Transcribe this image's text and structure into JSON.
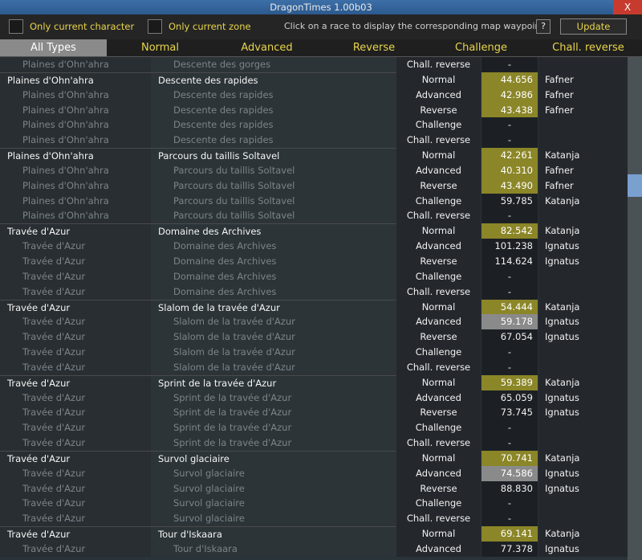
{
  "window": {
    "title": "DragonTimes 1.00b03",
    "close": "X"
  },
  "toolbar": {
    "only_character_label": "Only current character",
    "only_zone_label": "Only current zone",
    "hint": "Click on a race to display the corresponding map waypoint.",
    "help_label": "?",
    "update_label": "Update"
  },
  "tabs": [
    "All Types",
    "Normal",
    "Advanced",
    "Reverse",
    "Challenge",
    "Chall. reverse"
  ],
  "colors": {
    "gold_cell": "#8b8628",
    "gray_cell": "#8a8a8a",
    "accent_text": "#e8d44a"
  },
  "rows": [
    {
      "kind": "sub",
      "zone": "Plaines d'Ohn'ahra",
      "race": "Descente des gorges",
      "type": "Chall. reverse",
      "time": "-",
      "player": "",
      "hl": ""
    },
    {
      "kind": "main",
      "zone": "Plaines d'Ohn'ahra",
      "race": "Descente des rapides",
      "type": "Normal",
      "time": "44.656",
      "player": "Fafner",
      "hl": "gold"
    },
    {
      "kind": "sub",
      "zone": "Plaines d'Ohn'ahra",
      "race": "Descente des rapides",
      "type": "Advanced",
      "time": "42.986",
      "player": "Fafner",
      "hl": "gold"
    },
    {
      "kind": "sub",
      "zone": "Plaines d'Ohn'ahra",
      "race": "Descente des rapides",
      "type": "Reverse",
      "time": "43.438",
      "player": "Fafner",
      "hl": "gold"
    },
    {
      "kind": "sub",
      "zone": "Plaines d'Ohn'ahra",
      "race": "Descente des rapides",
      "type": "Challenge",
      "time": "-",
      "player": "",
      "hl": ""
    },
    {
      "kind": "sub",
      "zone": "Plaines d'Ohn'ahra",
      "race": "Descente des rapides",
      "type": "Chall. reverse",
      "time": "-",
      "player": "",
      "hl": ""
    },
    {
      "kind": "main",
      "zone": "Plaines d'Ohn'ahra",
      "race": "Parcours du taillis Soltavel",
      "type": "Normal",
      "time": "42.261",
      "player": "Katanja",
      "hl": "gold"
    },
    {
      "kind": "sub",
      "zone": "Plaines d'Ohn'ahra",
      "race": "Parcours du taillis Soltavel",
      "type": "Advanced",
      "time": "40.310",
      "player": "Fafner",
      "hl": "gold"
    },
    {
      "kind": "sub",
      "zone": "Plaines d'Ohn'ahra",
      "race": "Parcours du taillis Soltavel",
      "type": "Reverse",
      "time": "43.490",
      "player": "Fafner",
      "hl": "gold"
    },
    {
      "kind": "sub",
      "zone": "Plaines d'Ohn'ahra",
      "race": "Parcours du taillis Soltavel",
      "type": "Challenge",
      "time": "59.785",
      "player": "Katanja",
      "hl": ""
    },
    {
      "kind": "sub",
      "zone": "Plaines d'Ohn'ahra",
      "race": "Parcours du taillis Soltavel",
      "type": "Chall. reverse",
      "time": "-",
      "player": "",
      "hl": ""
    },
    {
      "kind": "main",
      "zone": "Travée d'Azur",
      "race": "Domaine des Archives",
      "type": "Normal",
      "time": "82.542",
      "player": "Katanja",
      "hl": "gold"
    },
    {
      "kind": "sub",
      "zone": "Travée d'Azur",
      "race": "Domaine des Archives",
      "type": "Advanced",
      "time": "101.238",
      "player": "Ignatus",
      "hl": ""
    },
    {
      "kind": "sub",
      "zone": "Travée d'Azur",
      "race": "Domaine des Archives",
      "type": "Reverse",
      "time": "114.624",
      "player": "Ignatus",
      "hl": ""
    },
    {
      "kind": "sub",
      "zone": "Travée d'Azur",
      "race": "Domaine des Archives",
      "type": "Challenge",
      "time": "-",
      "player": "",
      "hl": ""
    },
    {
      "kind": "sub",
      "zone": "Travée d'Azur",
      "race": "Domaine des Archives",
      "type": "Chall. reverse",
      "time": "-",
      "player": "",
      "hl": ""
    },
    {
      "kind": "main",
      "zone": "Travée d'Azur",
      "race": "Slalom de la travée d'Azur",
      "type": "Normal",
      "time": "54.444",
      "player": "Katanja",
      "hl": "gold"
    },
    {
      "kind": "sub",
      "zone": "Travée d'Azur",
      "race": "Slalom de la travée d'Azur",
      "type": "Advanced",
      "time": "59.178",
      "player": "Ignatus",
      "hl": "gray"
    },
    {
      "kind": "sub",
      "zone": "Travée d'Azur",
      "race": "Slalom de la travée d'Azur",
      "type": "Reverse",
      "time": "67.054",
      "player": "Ignatus",
      "hl": ""
    },
    {
      "kind": "sub",
      "zone": "Travée d'Azur",
      "race": "Slalom de la travée d'Azur",
      "type": "Challenge",
      "time": "-",
      "player": "",
      "hl": ""
    },
    {
      "kind": "sub",
      "zone": "Travée d'Azur",
      "race": "Slalom de la travée d'Azur",
      "type": "Chall. reverse",
      "time": "-",
      "player": "",
      "hl": ""
    },
    {
      "kind": "main",
      "zone": "Travée d'Azur",
      "race": "Sprint de la travée d'Azur",
      "type": "Normal",
      "time": "59.389",
      "player": "Katanja",
      "hl": "gold"
    },
    {
      "kind": "sub",
      "zone": "Travée d'Azur",
      "race": "Sprint de la travée d'Azur",
      "type": "Advanced",
      "time": "65.059",
      "player": "Ignatus",
      "hl": ""
    },
    {
      "kind": "sub",
      "zone": "Travée d'Azur",
      "race": "Sprint de la travée d'Azur",
      "type": "Reverse",
      "time": "73.745",
      "player": "Ignatus",
      "hl": ""
    },
    {
      "kind": "sub",
      "zone": "Travée d'Azur",
      "race": "Sprint de la travée d'Azur",
      "type": "Challenge",
      "time": "-",
      "player": "",
      "hl": ""
    },
    {
      "kind": "sub",
      "zone": "Travée d'Azur",
      "race": "Sprint de la travée d'Azur",
      "type": "Chall. reverse",
      "time": "-",
      "player": "",
      "hl": ""
    },
    {
      "kind": "main",
      "zone": "Travée d'Azur",
      "race": "Survol glaciaire",
      "type": "Normal",
      "time": "70.741",
      "player": "Katanja",
      "hl": "gold"
    },
    {
      "kind": "sub",
      "zone": "Travée d'Azur",
      "race": "Survol glaciaire",
      "type": "Advanced",
      "time": "74.586",
      "player": "Ignatus",
      "hl": "gray"
    },
    {
      "kind": "sub",
      "zone": "Travée d'Azur",
      "race": "Survol glaciaire",
      "type": "Reverse",
      "time": "88.830",
      "player": "Ignatus",
      "hl": ""
    },
    {
      "kind": "sub",
      "zone": "Travée d'Azur",
      "race": "Survol glaciaire",
      "type": "Challenge",
      "time": "-",
      "player": "",
      "hl": ""
    },
    {
      "kind": "sub",
      "zone": "Travée d'Azur",
      "race": "Survol glaciaire",
      "type": "Chall. reverse",
      "time": "-",
      "player": "",
      "hl": ""
    },
    {
      "kind": "main",
      "zone": "Travée d'Azur",
      "race": "Tour d'Iskaara",
      "type": "Normal",
      "time": "69.141",
      "player": "Katanja",
      "hl": "gold"
    },
    {
      "kind": "sub",
      "zone": "Travée d'Azur",
      "race": "Tour d'Iskaara",
      "type": "Advanced",
      "time": "77.378",
      "player": "Ignatus",
      "hl": ""
    }
  ]
}
